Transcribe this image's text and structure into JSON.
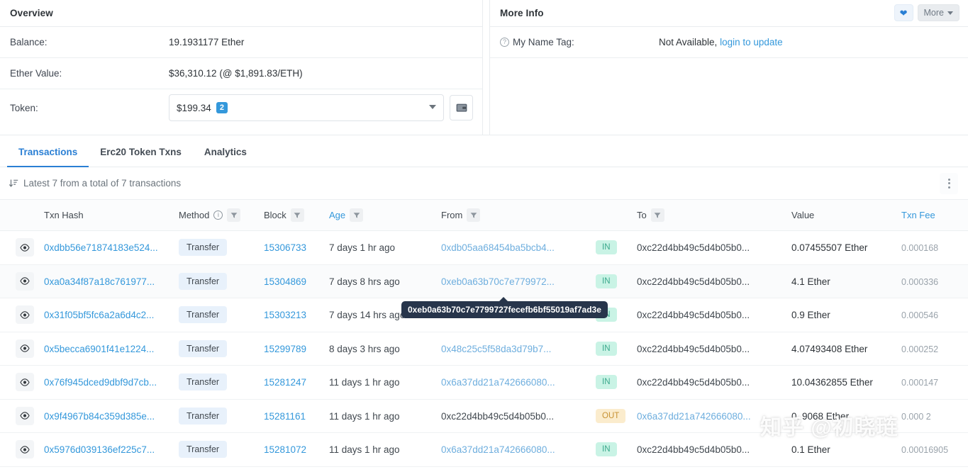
{
  "overview": {
    "title": "Overview",
    "rows": [
      {
        "label": "Balance:",
        "value": "19.1931177 Ether"
      },
      {
        "label": "Ether Value:",
        "value": "$36,310.12 (@ $1,891.83/ETH)"
      }
    ],
    "token_label": "Token:",
    "token_value": "$199.34",
    "token_count": "2",
    "wallet_icon": "wallet-icon",
    "caret_icon": "chevron-down-icon"
  },
  "more_info": {
    "title": "More Info",
    "favorite_icon": "heart-icon",
    "more_label": "More",
    "more_caret_icon": "chevron-down-icon",
    "name_tag": {
      "help_icon": "question-circle-icon",
      "label": "My Name Tag:",
      "value": "Not Available,",
      "link": "login to update"
    }
  },
  "tabs": [
    {
      "label": "Transactions",
      "active": true
    },
    {
      "label": "Erc20 Token Txns",
      "active": false
    },
    {
      "label": "Analytics",
      "active": false
    }
  ],
  "summary": {
    "sort_icon": "sort-descending-icon",
    "text": "Latest 7 from a total of 7 transactions",
    "menu_icon": "kebab-vertical-icon"
  },
  "table": {
    "columns": [
      {
        "key": "eye",
        "label": "",
        "filter": false,
        "info": false,
        "teal": false
      },
      {
        "key": "hash",
        "label": "Txn Hash",
        "filter": false,
        "info": false,
        "teal": false
      },
      {
        "key": "method",
        "label": "Method",
        "filter": true,
        "info": true,
        "teal": false
      },
      {
        "key": "block",
        "label": "Block",
        "filter": true,
        "info": false,
        "teal": false
      },
      {
        "key": "age",
        "label": "Age",
        "filter": true,
        "info": false,
        "teal": true
      },
      {
        "key": "from",
        "label": "From",
        "filter": true,
        "info": false,
        "teal": false
      },
      {
        "key": "dir",
        "label": "",
        "filter": false,
        "info": false,
        "teal": false
      },
      {
        "key": "to",
        "label": "To",
        "filter": true,
        "info": false,
        "teal": false
      },
      {
        "key": "value",
        "label": "Value",
        "filter": false,
        "info": false,
        "teal": false
      },
      {
        "key": "fee",
        "label": "Txn Fee",
        "filter": false,
        "info": false,
        "teal": true
      }
    ],
    "rows": [
      {
        "eye_icon": "eye-icon",
        "hash": "0xdbb56e71874183e524...",
        "method": "Transfer",
        "block": "15306733",
        "age": "7 days 1 hr ago",
        "from": "0xdb05aa68454ba5bcb4...",
        "from_link": true,
        "dir": "IN",
        "to": "0xc22d4bb49c5d4b05b0...",
        "to_link": false,
        "value": "0.07455507 Ether",
        "fee": "0.000168",
        "hovered": false
      },
      {
        "eye_icon": "eye-icon",
        "hash": "0xa0a34f87a18c761977...",
        "method": "Transfer",
        "block": "15304869",
        "age": "7 days 8 hrs ago",
        "from": "0xeb0a63b70c7e779972...",
        "from_link": true,
        "dir": "IN",
        "to": "0xc22d4bb49c5d4b05b0...",
        "to_link": false,
        "value": "4.1 Ether",
        "fee": "0.000336",
        "hovered": true
      },
      {
        "eye_icon": "eye-icon",
        "hash": "0x31f05bf5fc6a2a6d4c2...",
        "method": "Transfer",
        "block": "15303213",
        "age": "7 days 14 hrs ago",
        "from": "0xeb0a63b70c7e779972...",
        "from_link": true,
        "dir": "IN",
        "to": "0xc22d4bb49c5d4b05b0...",
        "to_link": false,
        "value": "0.9 Ether",
        "fee": "0.000546",
        "hovered": false
      },
      {
        "eye_icon": "eye-icon",
        "hash": "0x5becca6901f41e1224...",
        "method": "Transfer",
        "block": "15299789",
        "age": "8 days 3 hrs ago",
        "from": "0x48c25c5f58da3d79b7...",
        "from_link": true,
        "dir": "IN",
        "to": "0xc22d4bb49c5d4b05b0...",
        "to_link": false,
        "value": "4.07493408 Ether",
        "fee": "0.000252",
        "hovered": false
      },
      {
        "eye_icon": "eye-icon",
        "hash": "0x76f945dced9dbf9d7cb...",
        "method": "Transfer",
        "block": "15281247",
        "age": "11 days 1 hr ago",
        "from": "0x6a37dd21a742666080...",
        "from_link": true,
        "dir": "IN",
        "to": "0xc22d4bb49c5d4b05b0...",
        "to_link": false,
        "value": "10.04362855 Ether",
        "fee": "0.000147",
        "hovered": false
      },
      {
        "eye_icon": "eye-icon",
        "hash": "0x9f4967b84c359d385e...",
        "method": "Transfer",
        "block": "15281161",
        "age": "11 days 1 hr ago",
        "from": "0xc22d4bb49c5d4b05b0...",
        "from_link": false,
        "dir": "OUT",
        "to": "0x6a37dd21a742666080...",
        "to_link": true,
        "value": "0.   9068 Ether",
        "fee": "0.000 2",
        "hovered": false
      },
      {
        "eye_icon": "eye-icon",
        "hash": "0x5976d039136ef225c7...",
        "method": "Transfer",
        "block": "15281072",
        "age": "11 days 1 hr ago",
        "from": "0x6a37dd21a742666080...",
        "from_link": true,
        "dir": "IN",
        "to": "0xc22d4bb49c5d4b05b0...",
        "to_link": false,
        "value": "0.1 Ether",
        "fee": "0.00016905",
        "hovered": false
      }
    ]
  },
  "tooltip": {
    "text": "0xeb0a63b70c7e7799727fecefb6bf55019af7ad3e"
  },
  "watermark": {
    "text": "知乎 @初晓琏"
  },
  "colors": {
    "link": "#3498db",
    "accent": "#2a7fd4",
    "in_badge_bg": "#c9f3e5",
    "in_badge_text": "#3aa98c",
    "out_badge_bg": "#fbeccd",
    "out_badge_text": "#c79234",
    "tooltip_bg": "#27354b"
  }
}
